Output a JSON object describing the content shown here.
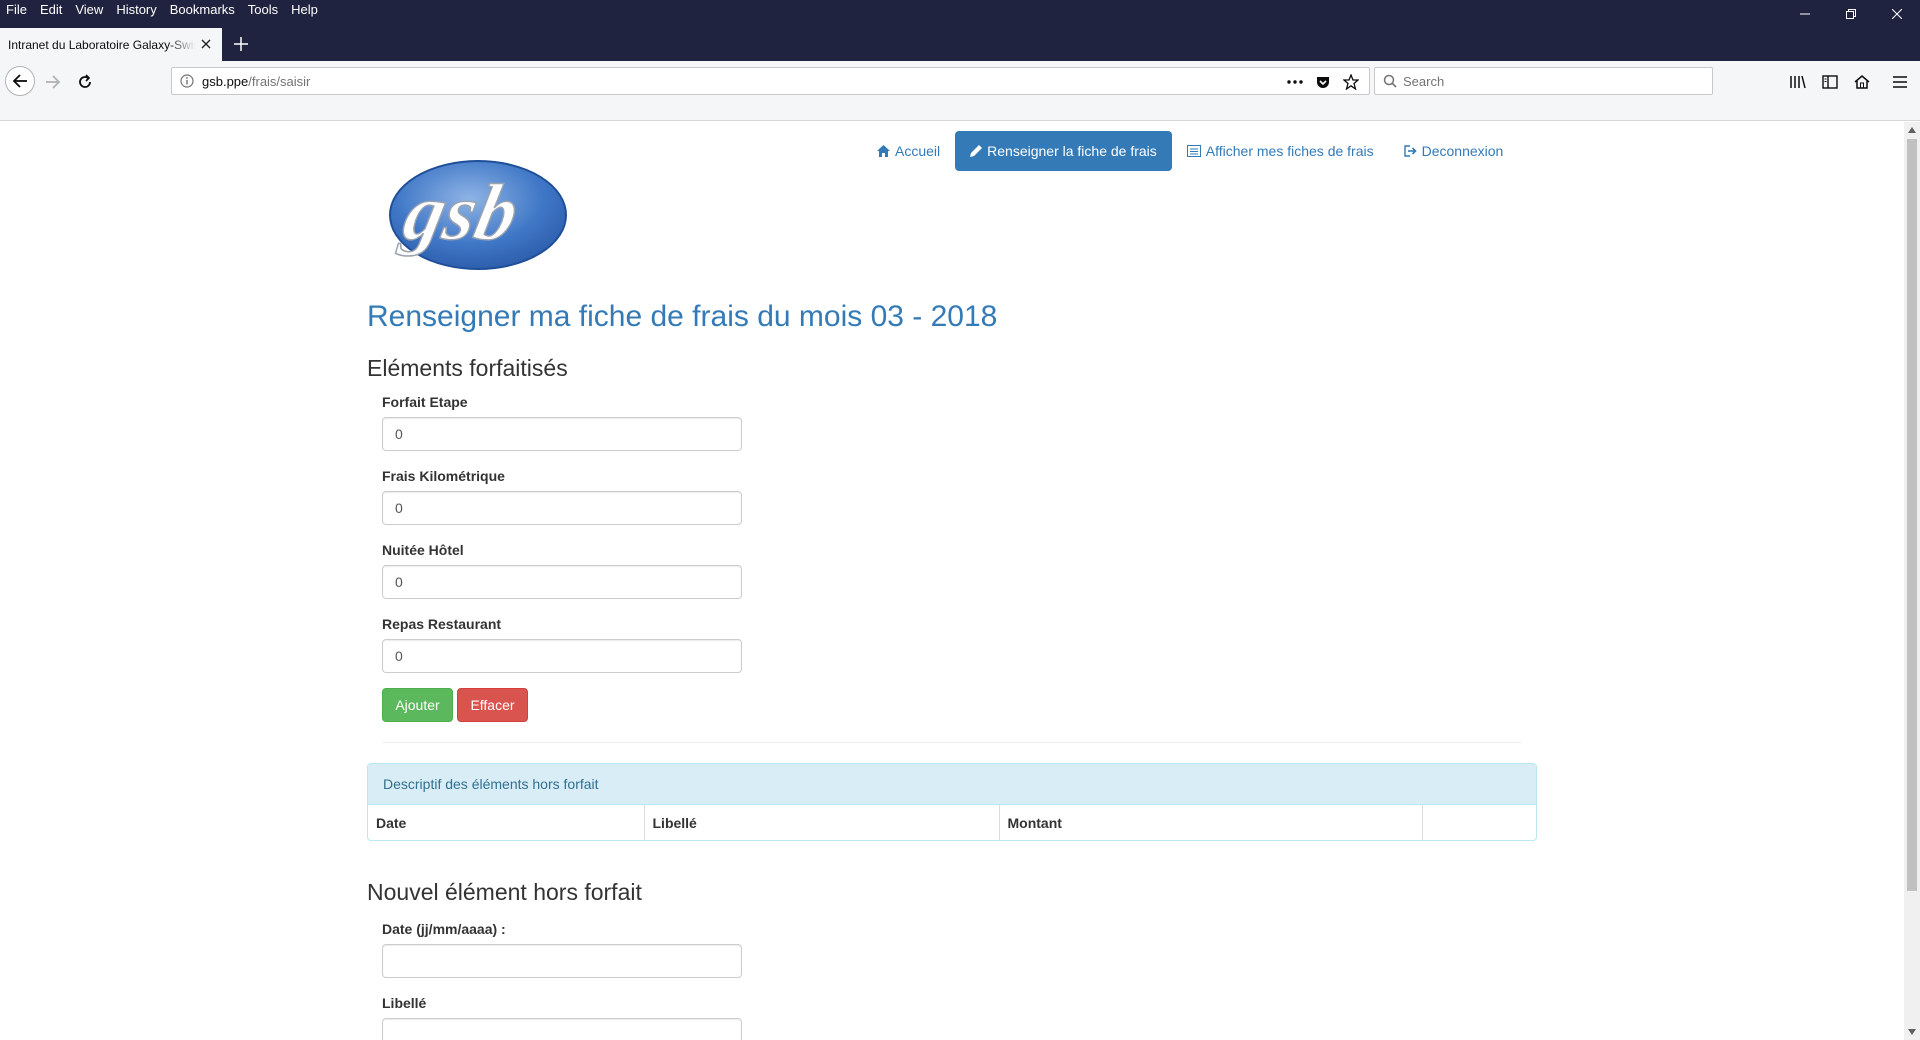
{
  "browser": {
    "menu": [
      "File",
      "Edit",
      "View",
      "History",
      "Bookmarks",
      "Tools",
      "Help"
    ],
    "tab_title": "Intranet du Laboratoire Galaxy-Swiss Bourdin",
    "url_domain": "gsb.ppe",
    "url_path": "/frais/saisir",
    "search_placeholder": "Search"
  },
  "nav": {
    "home": "Accueil",
    "enter_expense": "Renseigner la fiche de frais",
    "view_expenses": "Afficher mes fiches de frais",
    "logout": "Deconnexion"
  },
  "logo_text": "gsb",
  "page": {
    "title": "Renseigner ma fiche de frais du mois 03 - 2018",
    "section_fixed": "Eléments forfaitisés",
    "fields": [
      {
        "label": "Forfait Etape",
        "value": "0"
      },
      {
        "label": "Frais Kilométrique",
        "value": "0"
      },
      {
        "label": "Nuitée Hôtel",
        "value": "0"
      },
      {
        "label": "Repas Restaurant",
        "value": "0"
      }
    ],
    "btn_add": "Ajouter",
    "btn_clear": "Effacer",
    "panel_heading": "Descriptif des éléments hors forfait",
    "table_headers": [
      "Date",
      "Libellé",
      "Montant",
      ""
    ],
    "section_new": "Nouvel élément hors forfait",
    "new_fields": [
      {
        "label": "Date (jj/mm/aaaa) :",
        "value": ""
      },
      {
        "label": "Libellé",
        "value": ""
      }
    ]
  },
  "colors": {
    "titlebar": "#202340",
    "primary": "#337ab7",
    "success": "#5cb85c",
    "danger": "#d9534f",
    "panel_info": "#d9edf7"
  }
}
